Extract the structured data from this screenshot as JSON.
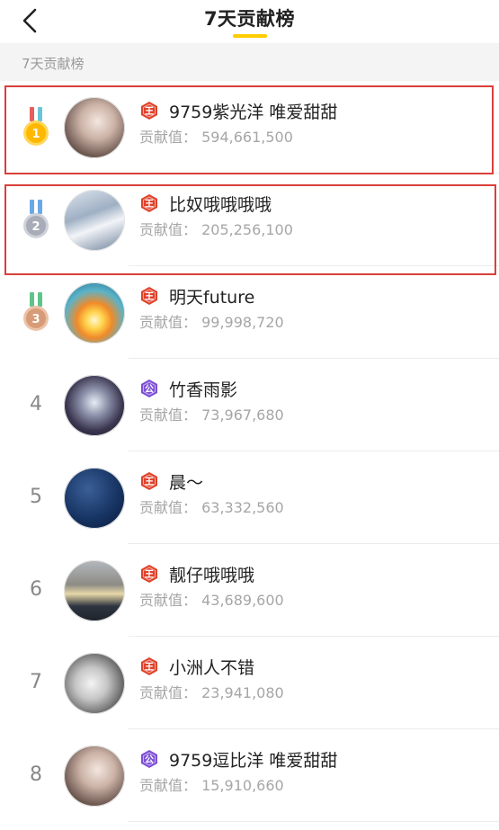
{
  "header": {
    "title": "7天贡献榜"
  },
  "section": {
    "label": "7天贡献榜"
  },
  "score_label": "贡献值：",
  "rows": [
    {
      "rank": "1",
      "badge": "王",
      "badge_type": "king",
      "name": "9759紫光洋  唯爱甜甜",
      "score": "594,661,500",
      "medal": "gold"
    },
    {
      "rank": "2",
      "badge": "王",
      "badge_type": "king",
      "name": "比奴哦哦哦哦",
      "score": "205,256,100",
      "medal": "silver"
    },
    {
      "rank": "3",
      "badge": "王",
      "badge_type": "king",
      "name": "明天future",
      "score": "99,998,720",
      "medal": "bronze"
    },
    {
      "rank": "4",
      "badge": "公",
      "badge_type": "duke",
      "name": "竹香雨影",
      "score": "73,967,680"
    },
    {
      "rank": "5",
      "badge": "王",
      "badge_type": "king",
      "name": "晨～",
      "score": "63,332,560"
    },
    {
      "rank": "6",
      "badge": "王",
      "badge_type": "king",
      "name": "靓仔哦哦哦",
      "score": "43,689,600"
    },
    {
      "rank": "7",
      "badge": "王",
      "badge_type": "king",
      "name": "小洲人不错",
      "score": "23,941,080"
    },
    {
      "rank": "8",
      "badge": "公",
      "badge_type": "duke",
      "name": "9759逗比洋 唯爱甜甜",
      "score": "15,910,660"
    }
  ],
  "colors": {
    "accent": "#ffcc00",
    "highlight_border": "#d9403b",
    "king_badge": "#e0422b",
    "duke_badge": "#7d4fd6",
    "score_text": "#a6a6a6"
  }
}
